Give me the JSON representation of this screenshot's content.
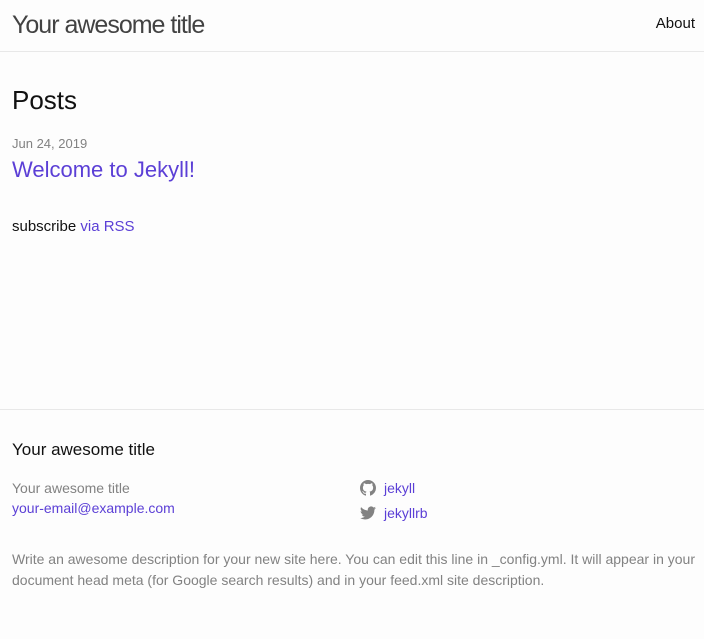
{
  "header": {
    "site_title": "Your awesome title",
    "nav": [
      {
        "label": "About"
      }
    ]
  },
  "main": {
    "heading": "Posts",
    "posts": [
      {
        "date": "Jun 24, 2019",
        "title": "Welcome to Jekyll!"
      }
    ],
    "rss": {
      "prefix": "subscribe",
      "link_label": "via RSS"
    }
  },
  "footer": {
    "heading": "Your awesome title",
    "name": "Your awesome title",
    "email": "your-email@example.com",
    "social": [
      {
        "icon": "github-icon",
        "label": "jekyll"
      },
      {
        "icon": "twitter-icon",
        "label": "jekyllrb"
      }
    ],
    "description": "Write an awesome description for your new site here. You can edit this line in _config.yml. It will appear in your document head meta (for Google search results) and in your feed.xml site description."
  },
  "colors": {
    "background": "#fdfdfd",
    "text": "#111111",
    "link": "#5b3fd6",
    "muted": "#828282",
    "border": "#e8e8e8"
  }
}
